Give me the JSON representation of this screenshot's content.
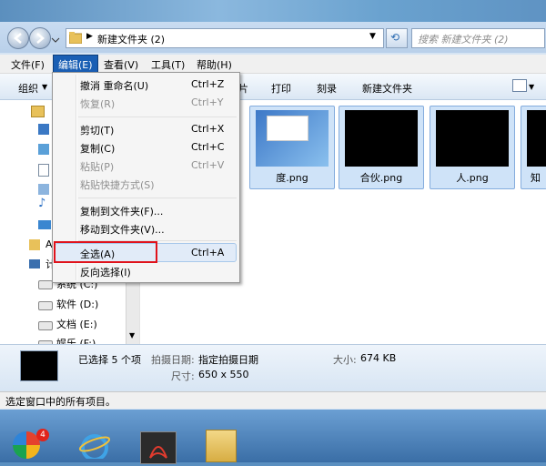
{
  "address": {
    "path": "新建文件夹 (2)",
    "search_placeholder": "搜索 新建文件夹 (2)"
  },
  "menubar": {
    "items": [
      "文件(F)",
      "编辑(E)",
      "查看(V)",
      "工具(T)",
      "帮助(H)"
    ]
  },
  "cmdbar": {
    "organize": "组织",
    "items": [
      "打印",
      "刻录",
      "新建文件夹"
    ],
    "partial": "片"
  },
  "nav": {
    "drives": [
      "系统 (C:)",
      "软件 (D:)",
      "文档 (E:)",
      "娱乐 (F:)"
    ],
    "partial_letters": [
      "A",
      "计"
    ]
  },
  "files": [
    "度.png",
    "合伙.png",
    "人.png",
    "知"
  ],
  "edit_menu": {
    "undo": "撤消 重命名(U)",
    "undo_sc": "Ctrl+Z",
    "redo": "恢复(R)",
    "redo_sc": "Ctrl+Y",
    "cut": "剪切(T)",
    "cut_sc": "Ctrl+X",
    "copy": "复制(C)",
    "copy_sc": "Ctrl+C",
    "paste": "粘贴(P)",
    "paste_sc": "Ctrl+V",
    "paste_shortcut": "粘贴快捷方式(S)",
    "copy_to": "复制到文件夹(F)...",
    "move_to": "移动到文件夹(V)...",
    "select_all": "全选(A)",
    "select_all_sc": "Ctrl+A",
    "invert": "反向选择(I)"
  },
  "details": {
    "selected": "已选择 5 个项",
    "date_label": "拍摄日期:",
    "date_value": "指定拍摄日期",
    "size_label": "大小:",
    "size_value": "674 KB",
    "dims_label": "尺寸:",
    "dims_value": "650 x 550"
  },
  "status": "选定窗口中的所有项目。",
  "colors": {
    "highlight": "#e0121b",
    "menu_active": "#1a5fb4"
  }
}
